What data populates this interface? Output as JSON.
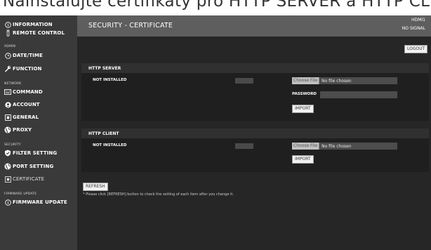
{
  "banner": {
    "text": "Nainstalujte certifikáty pro HTTP SERVER a HTTP CLIENT"
  },
  "sidebar": {
    "information": "INFORMATION",
    "remote_control": "REMOTE CONTROL",
    "admin_label": "ADMIN",
    "date_time": "DATE/TIME",
    "function": "FUNCTION",
    "network_label": "NETWORK",
    "command": "COMMAND",
    "account": "ACCOUNT",
    "general": "GENERAL",
    "proxy": "PROXY",
    "security_label": "SECURITY",
    "filter_setting": "FILTER SETTING",
    "port_setting": "PORT SETTING",
    "certificate": "CERTIFICATE",
    "firmware_label": "FIRMWARE UPDATE",
    "firmware_update": "FIRMWARE UPDATE"
  },
  "header": {
    "title": "SECURITY - CERTIFICATE",
    "input": "HDMI1",
    "signal": "NO SIGNAL"
  },
  "logout_label": "LOGOUT",
  "http_server": {
    "title": "HTTP SERVER",
    "status": "NOT INSTALLED",
    "file_button": "Choose File",
    "file_text": "No file chosen",
    "password_label": "PASSWORD",
    "password_value": "",
    "import_label": "IMPORT"
  },
  "http_client": {
    "title": "HTTP CLIENT",
    "status": "NOT INSTALLED",
    "file_button": "Choose File",
    "file_text": "No file chosen",
    "import_label": "IMPORT"
  },
  "refresh_label": "REFRESH",
  "note": "* Please click [REFRESH] button to check the setting of each item after you change it.",
  "icons": {
    "information": "info-circle-icon",
    "remote_control": "remote-icon",
    "date_time": "clock-icon",
    "function": "wrench-icon",
    "command": "keyboard-icon",
    "account": "user-circle-icon",
    "general": "general-icon",
    "proxy": "globe-icon",
    "filter_setting": "shield-icon",
    "port_setting": "globe-icon",
    "certificate": "certificate-icon",
    "firmware_update": "info-circle-icon"
  }
}
